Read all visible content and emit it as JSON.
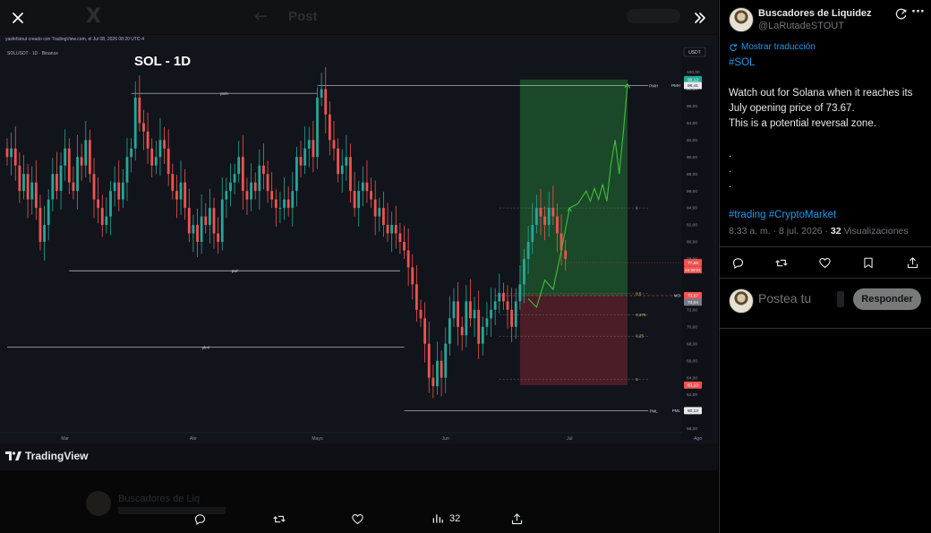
{
  "viewer": {
    "background_post_title": "Post",
    "background_author": "Buscadores de Liq",
    "chart_header": "yasfefstout creado con TradingView.com, el Jul 08, 2026 08:20 UTC-4",
    "tradingview_label": "TradingView",
    "actions": {
      "views": "32"
    }
  },
  "chart_data": {
    "type": "candlestick",
    "symbol_label": "SOLUSDT · 1D · Binance",
    "title": "SOL - 1D",
    "currency": "USDT",
    "ylim": [
      57,
      101
    ],
    "y_ticks": [
      {
        "label": "100,00",
        "v": 100
      },
      {
        "label": "98,00",
        "v": 98
      },
      {
        "label": "96,00",
        "v": 96
      },
      {
        "label": "94,00",
        "v": 94
      },
      {
        "label": "92,00",
        "v": 92
      },
      {
        "label": "90,00",
        "v": 90
      },
      {
        "label": "88,00",
        "v": 88
      },
      {
        "label": "86,00",
        "v": 86
      },
      {
        "label": "84,00",
        "v": 84
      },
      {
        "label": "82,00",
        "v": 82
      },
      {
        "label": "80,00",
        "v": 80
      },
      {
        "label": "78,00",
        "v": 78
      },
      {
        "label": "72,00",
        "v": 72
      },
      {
        "label": "70,00",
        "v": 70
      },
      {
        "label": "68,00",
        "v": 68
      },
      {
        "label": "66,00",
        "v": 66
      },
      {
        "label": "64,00",
        "v": 64
      },
      {
        "label": "62,00",
        "v": 62
      },
      {
        "label": "58,00",
        "v": 58
      }
    ],
    "x_ticks": [
      {
        "label": "Mar",
        "i": 14
      },
      {
        "label": "Abr",
        "i": 45
      },
      {
        "label": "Mayo",
        "i": 75
      },
      {
        "label": "Jun",
        "i": 106
      },
      {
        "label": "Jul",
        "i": 136
      },
      {
        "label": "Ago",
        "i": 167
      }
    ],
    "closes": [
      90,
      91,
      89,
      86,
      88,
      85,
      87,
      84,
      80,
      82,
      85,
      88,
      86,
      89,
      91,
      87,
      86,
      90,
      89,
      92,
      88,
      85,
      84,
      82,
      83,
      86,
      87,
      85,
      87,
      90,
      91,
      97,
      94,
      93,
      91,
      89,
      90,
      92,
      91,
      88,
      86,
      85,
      87,
      84,
      81,
      82,
      80,
      83,
      82,
      84,
      81,
      80,
      85,
      86,
      87,
      88,
      90,
      86,
      85,
      87,
      86,
      89,
      88,
      86,
      85,
      84,
      84,
      85,
      84,
      86,
      90,
      89,
      91,
      92,
      90,
      97,
      98,
      95,
      92,
      91,
      88,
      89,
      90,
      86,
      84,
      86,
      87,
      86,
      85,
      83,
      84,
      82,
      81,
      82,
      81,
      80,
      79,
      77,
      75,
      72,
      71,
      68,
      64,
      63,
      66,
      64,
      68,
      71,
      73,
      70,
      69,
      73,
      71,
      72,
      68,
      70,
      71,
      72,
      73,
      74,
      73,
      72,
      70,
      73,
      75,
      78,
      80,
      82,
      84,
      83,
      82,
      84,
      83,
      81,
      79,
      78
    ],
    "levels": [
      {
        "label": "pmh",
        "value": 97.5,
        "from": 30,
        "to": 75
      },
      {
        "label": "PMH",
        "value": 98.41,
        "from": 75,
        "to": 155
      },
      {
        "label": "pwl",
        "value": 76.6,
        "from": 15,
        "to": 95
      },
      {
        "label": "plml",
        "value": 67.6,
        "from": 0,
        "to": 96
      },
      {
        "label": "PML",
        "value": 60.13,
        "from": 96,
        "to": 155
      }
    ],
    "fib_levels": [
      {
        "label": "1",
        "value": 84
      },
      {
        "label": "0.5",
        "value": 73.9
      },
      {
        "label": "0,375",
        "value": 71.4
      },
      {
        "label": "0,25",
        "value": 68.9
      },
      {
        "label": "0",
        "value": 63.8
      }
    ],
    "target_zone": {
      "from": 124,
      "to": 150,
      "top": 99.12,
      "entry": 73.67,
      "bottom": 63.13
    },
    "projection": [
      [
        126,
        73.3
      ],
      [
        128,
        72.3
      ],
      [
        130,
        75.5
      ],
      [
        132,
        74.4
      ],
      [
        134,
        79
      ],
      [
        136,
        84
      ],
      [
        138,
        84.5
      ],
      [
        140,
        86
      ],
      [
        141,
        84.8
      ],
      [
        142,
        86.3
      ],
      [
        143,
        85
      ],
      [
        144,
        86.8
      ],
      [
        145,
        84.8
      ],
      [
        146,
        89.2
      ],
      [
        147,
        92
      ],
      [
        148,
        88
      ],
      [
        149,
        93
      ],
      [
        150,
        98.6
      ]
    ],
    "price_tags": [
      {
        "label": "99,12",
        "value": 99.12,
        "color": "#26a69a"
      },
      {
        "label": "98,41",
        "value": 98.41,
        "color": "#e8eaee"
      },
      {
        "label": "77,56",
        "value": 77.56,
        "color": "#ef5350"
      },
      {
        "label": "73,67",
        "value": 73.67,
        "color": "#ef5350"
      },
      {
        "label": "73,04",
        "value": 72.9,
        "color": "#787b86"
      },
      {
        "label": "63,13",
        "value": 63.13,
        "color": "#ef5350"
      },
      {
        "label": "60,13",
        "value": 60.13,
        "color": "#e8eaee"
      }
    ],
    "price_countdown": "15:39:01",
    "right_labels": [
      {
        "label": "PMH",
        "value": 98.41
      },
      {
        "label": "MO",
        "value": 73.67
      },
      {
        "label": "PML",
        "value": 60.13
      }
    ]
  },
  "tweet": {
    "author_name": "Buscadores de Liquidez",
    "author_handle": "@LaRutadeSTOUT",
    "translate_label": "Mostrar traducción",
    "lines": [
      {
        "text": "#SOL",
        "kind": "hashtag"
      },
      {
        "text": "",
        "kind": "blank"
      },
      {
        "text": "Watch out for Solana when it reaches its",
        "kind": "text"
      },
      {
        "text": "July opening price of 73.67.",
        "kind": "text"
      },
      {
        "text": "This is a potential reversal zone.",
        "kind": "text"
      },
      {
        "text": "",
        "kind": "blank"
      },
      {
        "text": ".",
        "kind": "text"
      },
      {
        "text": ".",
        "kind": "text"
      },
      {
        "text": ".",
        "kind": "text"
      },
      {
        "text": "",
        "kind": "blank"
      },
      {
        "text": "#trading #CryptoMarket",
        "kind": "hashtag"
      }
    ],
    "time": "8:33 a. m.",
    "date": "8 jul. 2026",
    "separator": "·",
    "views_count": "32",
    "views_label": "Visualizaciones"
  },
  "reply": {
    "placeholder": "Postea tu",
    "button_label": "Responder"
  }
}
